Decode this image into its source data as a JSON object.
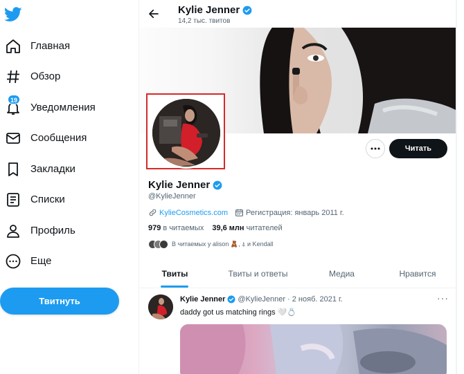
{
  "colors": {
    "accent": "#1d9bf0",
    "text": "#0f1419",
    "muted": "#536471",
    "highlight": "#d62828"
  },
  "sidebar": {
    "logo_icon": "twitter-bird-icon",
    "items": [
      {
        "label": "Главная",
        "icon": "home-icon"
      },
      {
        "label": "Обзор",
        "icon": "hashtag-icon"
      },
      {
        "label": "Уведомления",
        "icon": "bell-icon",
        "badge": "19"
      },
      {
        "label": "Сообщения",
        "icon": "envelope-icon"
      },
      {
        "label": "Закладки",
        "icon": "bookmark-icon"
      },
      {
        "label": "Списки",
        "icon": "list-icon"
      },
      {
        "label": "Профиль",
        "icon": "person-icon"
      },
      {
        "label": "Еще",
        "icon": "more-circle-icon"
      }
    ],
    "tweet_button": "Твитнуть"
  },
  "header": {
    "name": "Kylie Jenner",
    "tweet_count": "14,2 тыс. твитов"
  },
  "profile": {
    "name": "Kylie Jenner",
    "handle": "@KylieJenner",
    "website": "KylieCosmetics.com",
    "joined": "Регистрация: январь 2011 г.",
    "following_count": "979",
    "following_label": "в читаемых",
    "followers_count": "39,6 млн",
    "followers_label": "читателей",
    "followed_by": "В читаемых у alison 🧸, ⍋ и Kendall",
    "follow_button": "Читать"
  },
  "tabs": [
    "Твиты",
    "Твиты и ответы",
    "Медиа",
    "Нравится"
  ],
  "tweet": {
    "name": "Kylie Jenner",
    "handle": "@KylieJenner",
    "date": "2 нояб. 2021 г.",
    "text": "daddy got us matching rings 🤍💍"
  }
}
